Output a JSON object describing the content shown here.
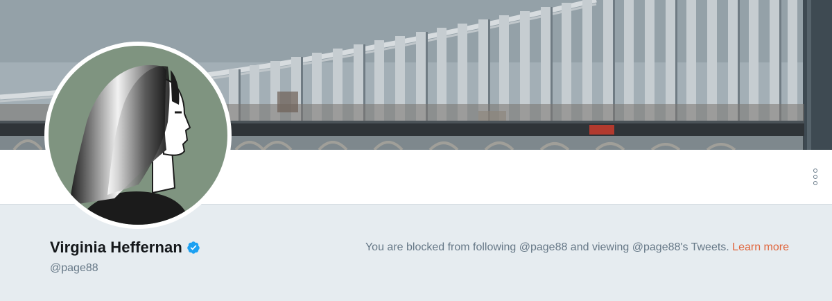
{
  "profile": {
    "name": "Virginia Heffernan",
    "handle": "@page88",
    "verified": true
  },
  "blocked_notice": {
    "text": "You are blocked from following @page88 and viewing @page88's Tweets. ",
    "link_label": "Learn more"
  },
  "icons": {
    "verified": "verified-badge-icon",
    "more": "more-vertical-icon"
  },
  "colors": {
    "page_background": "#e6ecf0",
    "verified_blue": "#1da1f2",
    "link_orange": "#e0643b",
    "avatar_background": "#7f9480"
  }
}
